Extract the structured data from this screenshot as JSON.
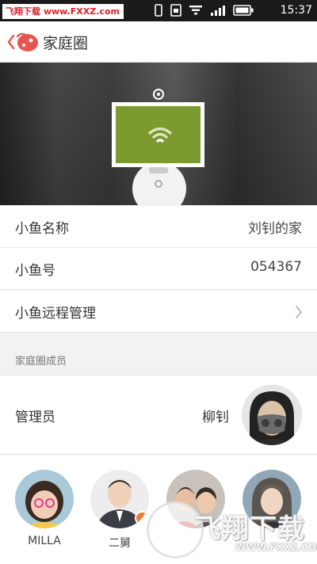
{
  "status_bar": {
    "watermark": "飞翔下载 www.FXXZ.com",
    "time": "15:37",
    "icons": [
      "vibrate-icon",
      "sim-icon",
      "wifi-icon",
      "signal-icon",
      "battery-icon"
    ]
  },
  "app_bar": {
    "title": "家庭圈",
    "logo_icon": "fish-logo-icon",
    "accent_color": "#e8554e"
  },
  "hero": {
    "screen_color": "#7c9a2d",
    "icons": [
      "camera-dot-icon",
      "wifi-icon"
    ]
  },
  "info_rows": [
    {
      "label": "小鱼名称",
      "value": "刘钊的家"
    },
    {
      "label": "小鱼号",
      "value": "054367"
    },
    {
      "label": "小鱼远程管理",
      "value": ""
    }
  ],
  "section_header": "家庭圈成员",
  "admin": {
    "label": "管理员",
    "name": "柳钊"
  },
  "members": [
    {
      "name": "MILLA"
    },
    {
      "name": "二舅"
    },
    {
      "name": ""
    },
    {
      "name": ""
    }
  ],
  "watermark_bottom": {
    "big": "飞翔下载",
    "small": "WWW.FXXZ.COM"
  }
}
